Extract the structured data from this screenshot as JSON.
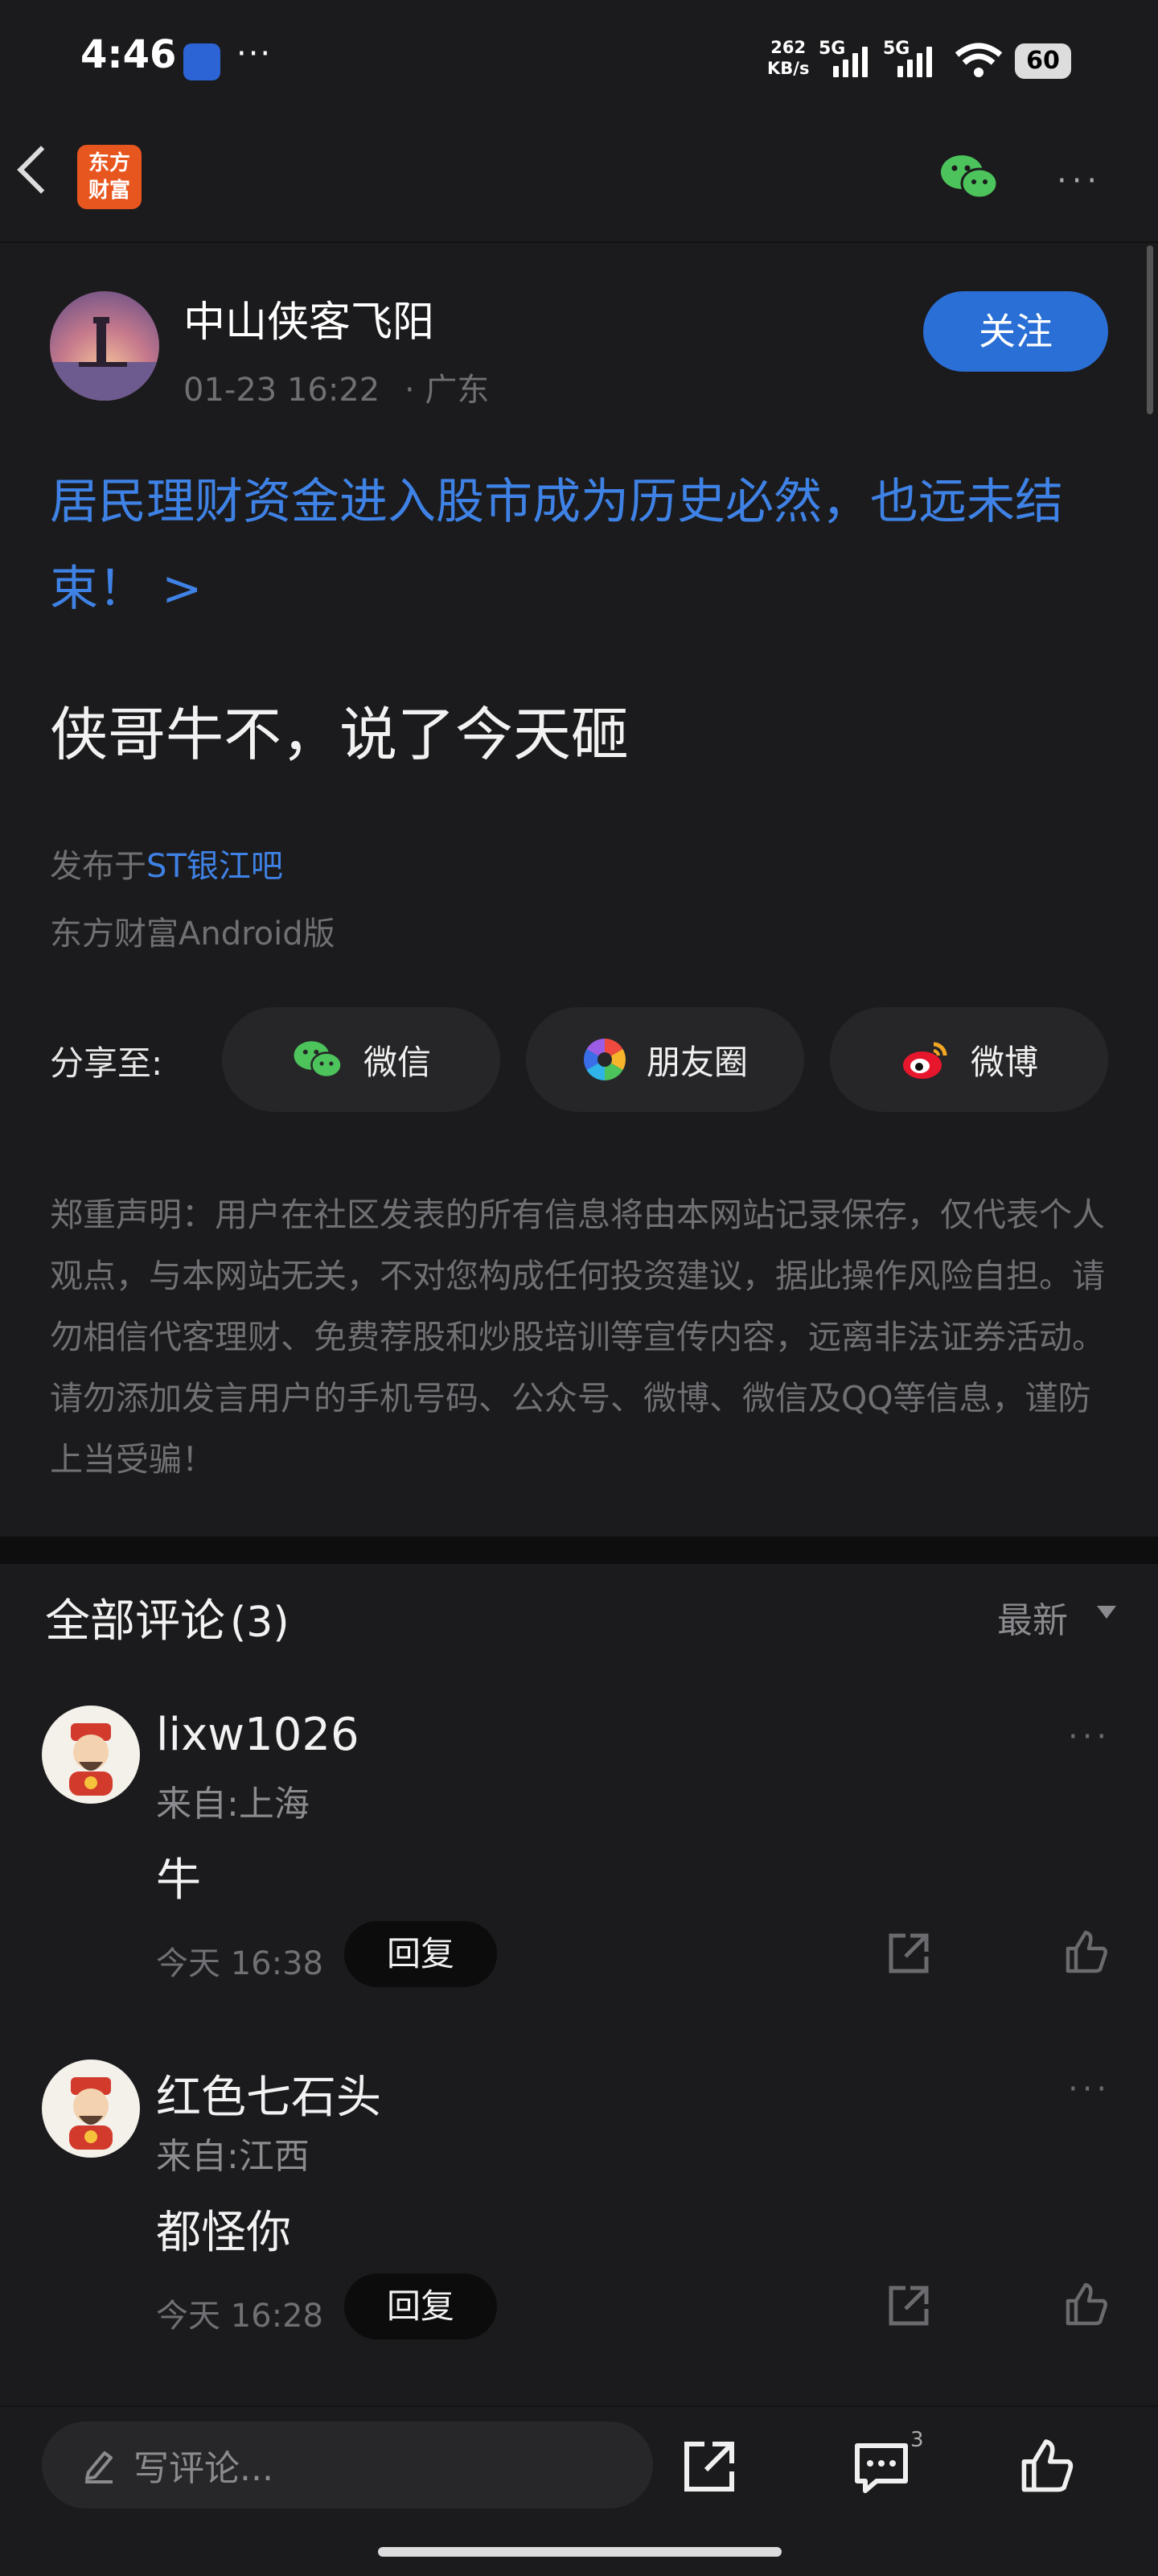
{
  "status_bar": {
    "time": "4:46",
    "more": "···",
    "speed_value": "262",
    "speed_unit": "KB/s",
    "net1": "5G",
    "net2": "5G",
    "battery": "60"
  },
  "nav": {
    "logo_text_1": "东方",
    "logo_text_2": "财富",
    "more": "···"
  },
  "post": {
    "author": "中山侠客飞阳",
    "datetime": "01-23 16:22",
    "location": "· 广东",
    "follow_label": "关注",
    "title": "居民理财资金进入股市成为历史必然，也远未结束！ >",
    "body": "侠哥牛不，说了今天砸",
    "published_prefix": "发布于",
    "published_bar": "ST银江吧",
    "client": "东方财富Android版"
  },
  "share": {
    "label": "分享至:",
    "wechat": "微信",
    "moments": "朋友圈",
    "weibo": "微博"
  },
  "disclaimer": "郑重声明：用户在社区发表的所有信息将由本网站记录保存，仅代表个人观点，与本网站无关，不对您构成任何投资建议，据此操作风险自担。请勿相信代客理财、免费荐股和炒股培训等宣传内容，远离非法证券活动。请勿添加发言用户的手机号码、公众号、微博、微信及QQ等信息，谨防上当受骗！",
  "comments_header": {
    "title": "全部评论",
    "count": "(3)",
    "sort": "最新"
  },
  "comments": [
    {
      "name": "lixw1026",
      "from": "来自:上海",
      "text": "牛",
      "time": "今天 16:38",
      "reply": "回复",
      "more": "···"
    },
    {
      "name": "红色七石头",
      "from": "来自:江西",
      "text": "都怪你",
      "time": "今天 16:28",
      "reply": "回复",
      "more": "···"
    }
  ],
  "bottom_bar": {
    "placeholder": "写评论...",
    "comment_badge": "3"
  },
  "colors": {
    "accent": "#2a6fd6",
    "link": "#3f82e6",
    "background": "#1b1b1d"
  }
}
